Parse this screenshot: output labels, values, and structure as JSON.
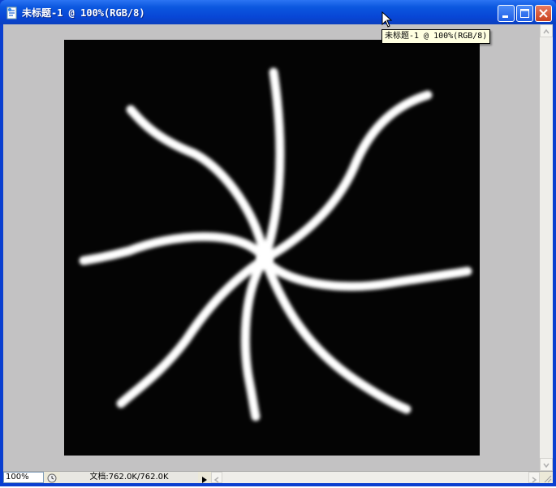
{
  "window": {
    "title": "未标题-1 @ 100%(RGB/8)",
    "icons": [
      "document-icon",
      "minimize-icon",
      "maximize-icon",
      "close-icon"
    ]
  },
  "canvas": {
    "background_color": "#040404",
    "stroke_color": "#ffffff",
    "content": "white glowing swirl strokes radiating from center"
  },
  "tooltip": {
    "text": "未标题-1 @ 100%(RGB/8)"
  },
  "status": {
    "zoom": "100%",
    "doc_info": "文档:762.0K/762.0K"
  },
  "colors": {
    "titlebar": "#0b57df",
    "workspace": "#c3c2c3",
    "close_button": "#c9421f"
  }
}
